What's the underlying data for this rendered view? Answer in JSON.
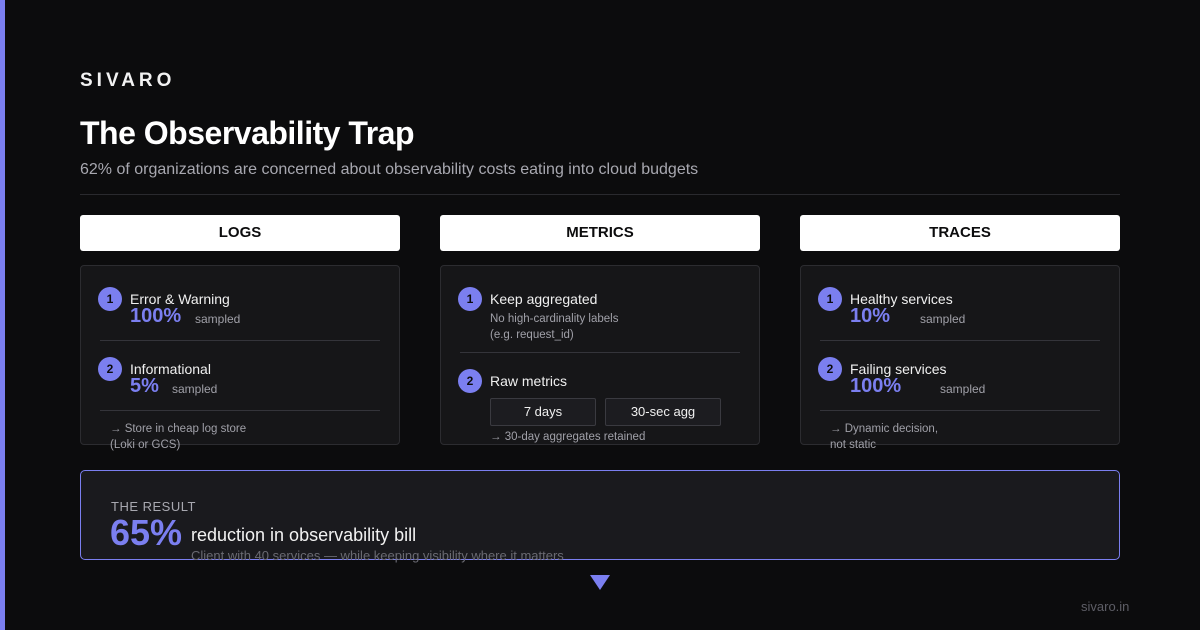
{
  "brand": "SIVARO",
  "title": "The Observability Trap",
  "subtitle": "62% of organizations are concerned about observability costs eating into cloud budgets",
  "columns": [
    {
      "header": "LOGS",
      "items": [
        {
          "num": "1",
          "label": "Error & Warning",
          "value": "100%",
          "suffix": "sampled"
        },
        {
          "num": "2",
          "label": "Informational",
          "value": "5%",
          "suffix": "sampled"
        }
      ],
      "note_line1": "→ Store in cheap log store",
      "note_line2": "(Loki or GCS)"
    },
    {
      "header": "METRICS",
      "items": [
        {
          "num": "1",
          "label": "Keep aggregated",
          "desc_line1": "No high-cardinality labels",
          "desc_line2": "(e.g. request_id)"
        },
        {
          "num": "2",
          "label": "Raw metrics",
          "pill1": "7 days",
          "pill2": "30-sec agg"
        }
      ],
      "note_line1": "→ 30-day aggregates retained"
    },
    {
      "header": "TRACES",
      "items": [
        {
          "num": "1",
          "label": "Healthy services",
          "value": "10%",
          "suffix": "sampled"
        },
        {
          "num": "2",
          "label": "Failing services",
          "value": "100%",
          "suffix": "sampled"
        }
      ],
      "note_line1": "→ Dynamic decision,",
      "note_line2": "not static"
    }
  ],
  "result": {
    "label": "THE RESULT",
    "value": "65%",
    "text": "reduction in observability bill",
    "note": "Client with 40 services — while keeping visibility where it matters"
  },
  "footer": "sivaro.in",
  "colors": {
    "accent": "#7b7ff0",
    "background": "#0c0c0d",
    "card": "#161618"
  }
}
